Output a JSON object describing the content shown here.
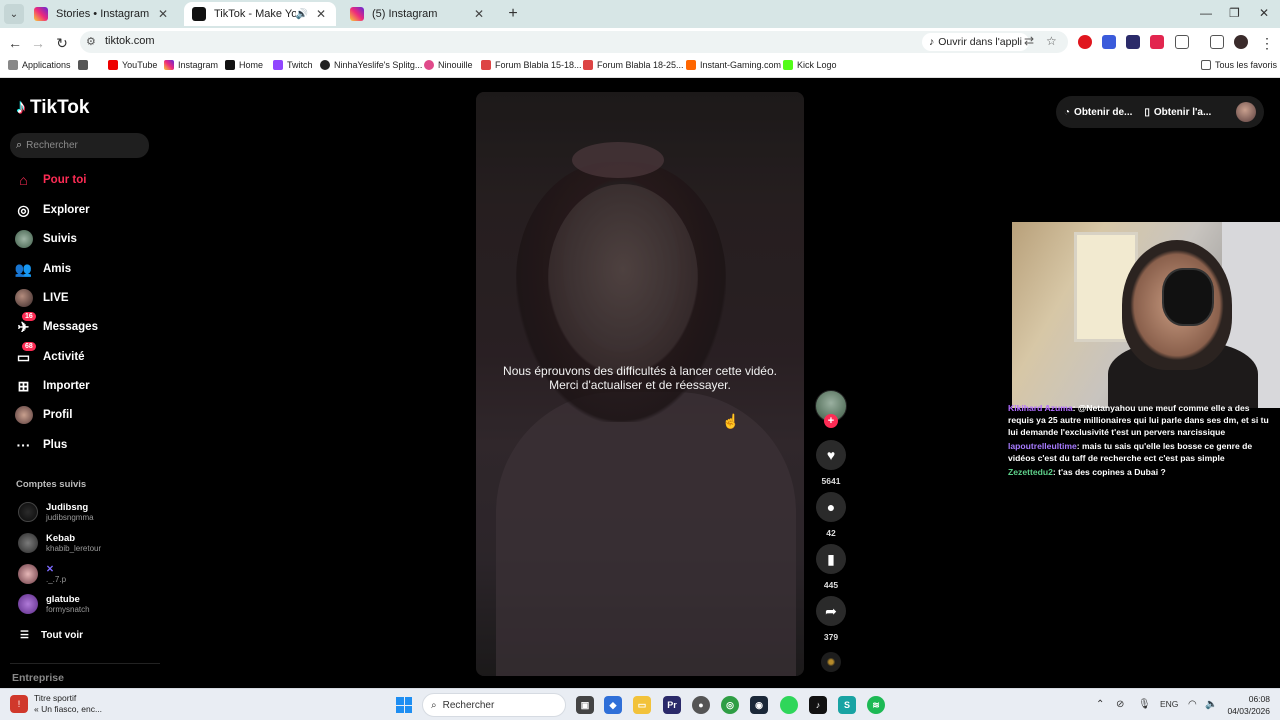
{
  "browser": {
    "tabs": [
      {
        "title": "Stories • Instagram",
        "active": false
      },
      {
        "title": "TikTok - Make Your Day",
        "active": true
      },
      {
        "title": "(5) Instagram",
        "active": false
      }
    ],
    "url": "tiktok.com",
    "open_app_label": "Ouvrir dans l'appli",
    "bookmarks": [
      "Applications",
      "YouTube",
      "Instagram",
      "Home",
      "Twitch",
      "NinhaYeslife's Splitg...",
      "Ninouille",
      "Forum Blabla 15-18...",
      "Forum Blabla 18-25...",
      "Instant-Gaming.com",
      "Kick Logo"
    ],
    "all_favorites": "Tous les favoris"
  },
  "tiktok": {
    "logo": "TikTok",
    "search_placeholder": "Rechercher",
    "nav": [
      {
        "label": "Pour toi"
      },
      {
        "label": "Explorer"
      },
      {
        "label": "Suivis"
      },
      {
        "label": "Amis"
      },
      {
        "label": "LIVE"
      },
      {
        "label": "Messages",
        "badge": "16"
      },
      {
        "label": "Activité",
        "badge": "68"
      },
      {
        "label": "Importer"
      },
      {
        "label": "Profil"
      },
      {
        "label": "Plus"
      }
    ],
    "following_title": "Comptes suivis",
    "following": [
      {
        "name": "Judibsng",
        "user": "judibsngmma"
      },
      {
        "name": "Kebab",
        "user": "khabib_leretour"
      },
      {
        "name": "",
        "user": "._.7.p"
      },
      {
        "name": "glatube",
        "user": "formysnatch"
      }
    ],
    "see_all": "Tout voir",
    "business": "Entreprise",
    "video_error": {
      "line1": "Nous éprouvons des difficultés à lancer cette vidéo.",
      "line2": "Merci d'actualiser et de réessayer."
    },
    "actions": {
      "likes": "5641",
      "comments": "42",
      "saves": "445",
      "shares": "379"
    },
    "top_right": {
      "get_coins": "Obtenir de...",
      "get_app": "Obtenir l'a..."
    }
  },
  "stream_chat": [
    {
      "user": "Kikihard Azuma",
      "text": "@Netanyahou une meuf comme elle a des requis ya 25 autre millionaires qui lui parle dans ses dm, et si tu lui demande l'exclusivité t'est un pervers narcissique"
    },
    {
      "user": "lapoutrelleultime",
      "text": "mais tu sais qu'elle les bosse ce genre de vidéos c'est du taff de recherche ect c'est pas simple"
    },
    {
      "user": "Zezettedu2",
      "text": "t'as des copines a Dubai ?"
    }
  ],
  "taskbar": {
    "widget_title": "Titre sportif",
    "widget_sub": "« Un fiasco, enc...",
    "search_label": "Rechercher",
    "lang": "ENG",
    "time": "06:08",
    "date": "04/03/2026"
  }
}
